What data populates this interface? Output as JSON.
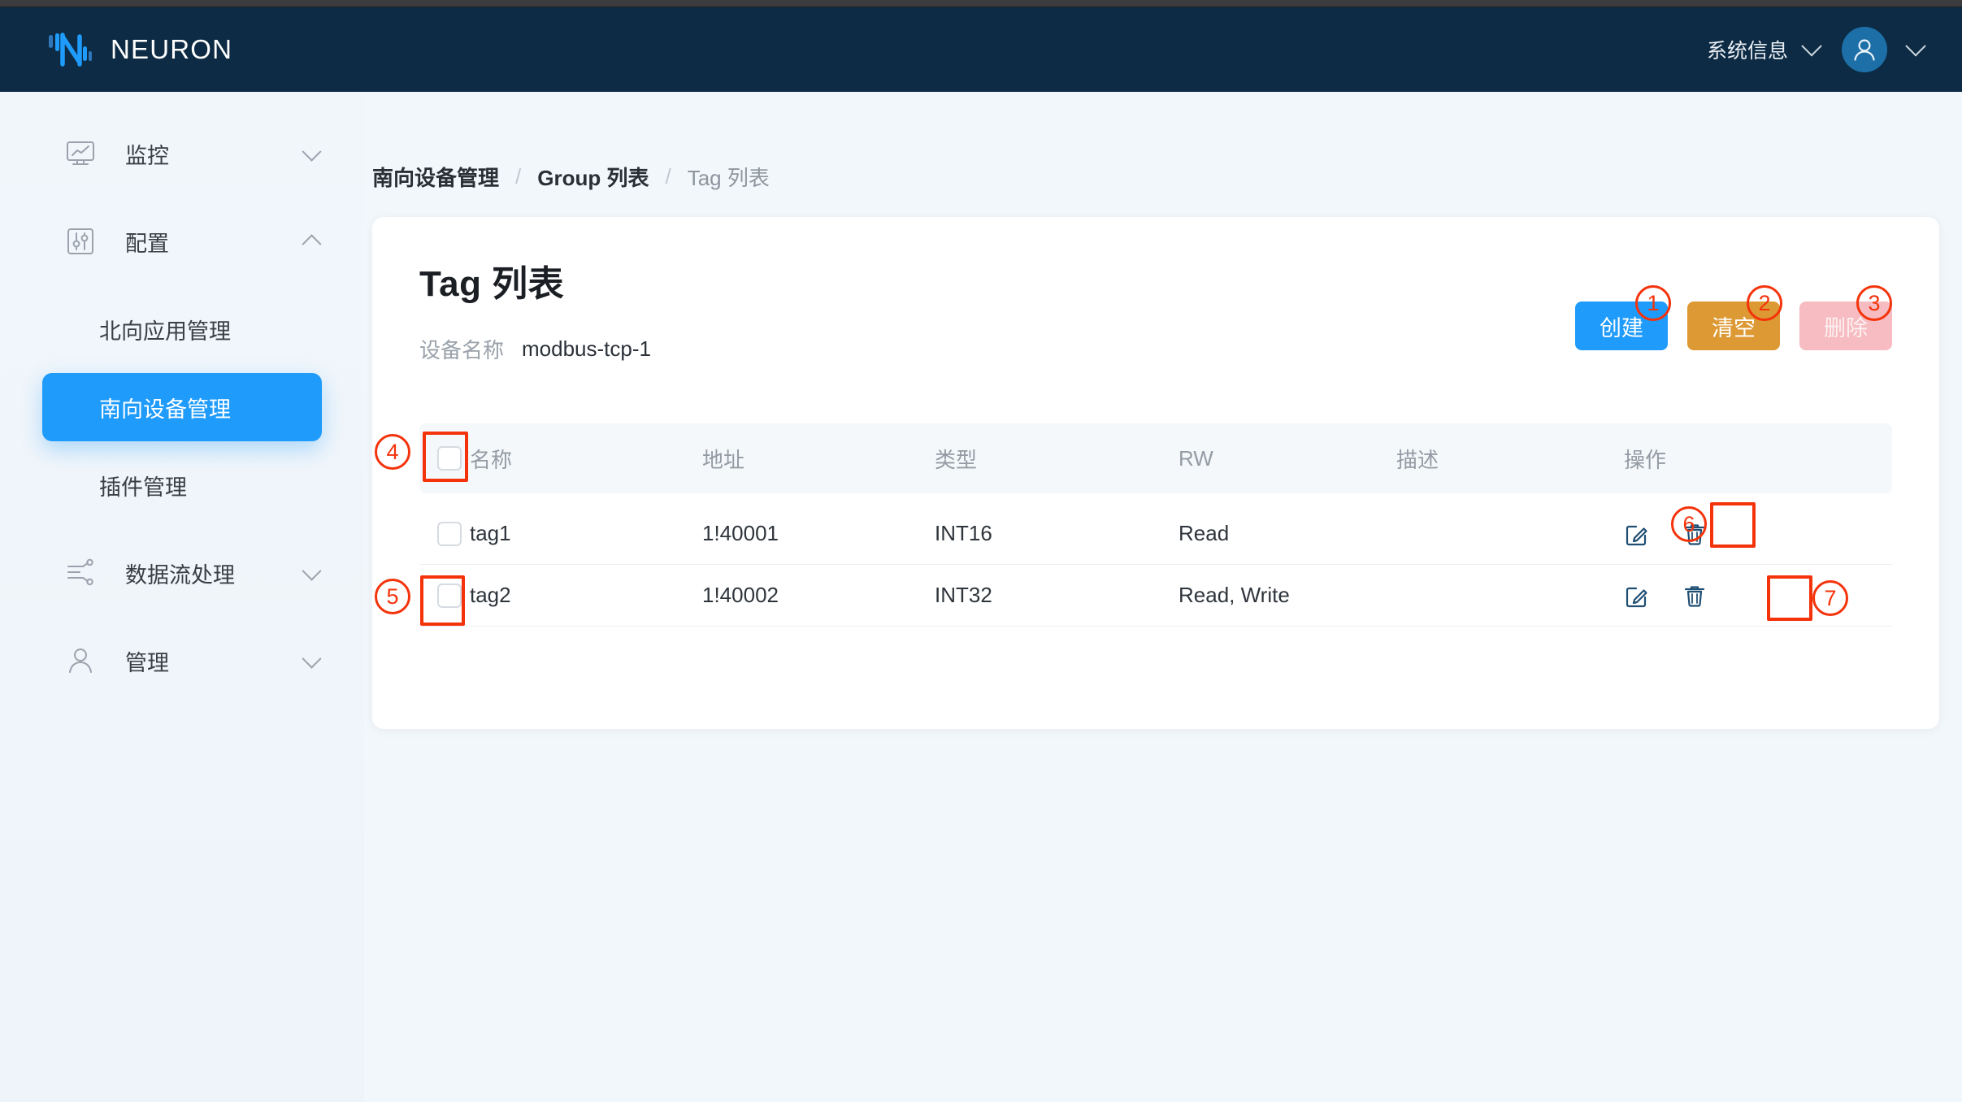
{
  "header": {
    "brand": "NEURON",
    "logo_icon": "neuron-logo-icon",
    "sysinfo_label": "系统信息",
    "sysinfo_chevron": "chevron-down-icon",
    "avatar_icon": "user-avatar-icon",
    "avatar_chevron": "chevron-down-icon"
  },
  "sidebar": {
    "items": [
      {
        "label": "监控",
        "icon": "monitor-chart-icon",
        "type": "group",
        "chevron": "down",
        "active": false
      },
      {
        "label": "配置",
        "icon": "sliders-config-icon",
        "type": "group",
        "chevron": "up",
        "active": false
      },
      {
        "label": "北向应用管理",
        "icon": "",
        "type": "sub",
        "chevron": "",
        "active": false
      },
      {
        "label": "南向设备管理",
        "icon": "",
        "type": "sub",
        "chevron": "",
        "active": true
      },
      {
        "label": "插件管理",
        "icon": "",
        "type": "sub",
        "chevron": "",
        "active": false
      },
      {
        "label": "数据流处理",
        "icon": "dataflow-icon",
        "type": "group",
        "chevron": "down",
        "active": false
      },
      {
        "label": "管理",
        "icon": "user-manage-icon",
        "type": "group",
        "chevron": "down",
        "active": false
      }
    ]
  },
  "breadcrumb": {
    "items": [
      {
        "label": "南向设备管理",
        "style": "bold"
      },
      {
        "label": "Group 列表",
        "style": "bold"
      },
      {
        "label": "Tag 列表",
        "style": "mute"
      }
    ],
    "separator": "/"
  },
  "card": {
    "title": "Tag 列表",
    "device_label": "设备名称",
    "device_value": "modbus-tcp-1",
    "buttons": [
      {
        "label": "创建",
        "name": "create-button",
        "color": "#1f9bfb"
      },
      {
        "label": "清空",
        "name": "clear-button",
        "color": "#dd9933"
      },
      {
        "label": "删除",
        "name": "delete-button",
        "color": "#f6bcc1"
      }
    ]
  },
  "table": {
    "columns": [
      "名称",
      "地址",
      "类型",
      "RW",
      "描述",
      "操作"
    ],
    "header_checkbox": {
      "checked": false,
      "name": "select-all-checkbox"
    },
    "rows": [
      {
        "checked": false,
        "name": "tag1",
        "address": "1!40001",
        "type": "INT16",
        "rw": "Read",
        "description": "",
        "ops": [
          "edit-icon",
          "delete-icon"
        ]
      },
      {
        "checked": false,
        "name": "tag2",
        "address": "1!40002",
        "type": "INT32",
        "rw": "Read, Write",
        "description": "",
        "ops": [
          "edit-icon",
          "delete-icon"
        ]
      }
    ]
  },
  "annotations": {
    "color": "#f4330b",
    "markers": [
      {
        "n": "1",
        "target": "create-button"
      },
      {
        "n": "2",
        "target": "clear-button"
      },
      {
        "n": "3",
        "target": "delete-button"
      },
      {
        "n": "4",
        "target": "select-all-checkbox"
      },
      {
        "n": "5",
        "target": "row2-checkbox"
      },
      {
        "n": "6",
        "target": "row1-edit-icon"
      },
      {
        "n": "7",
        "target": "row2-delete-icon"
      }
    ]
  }
}
